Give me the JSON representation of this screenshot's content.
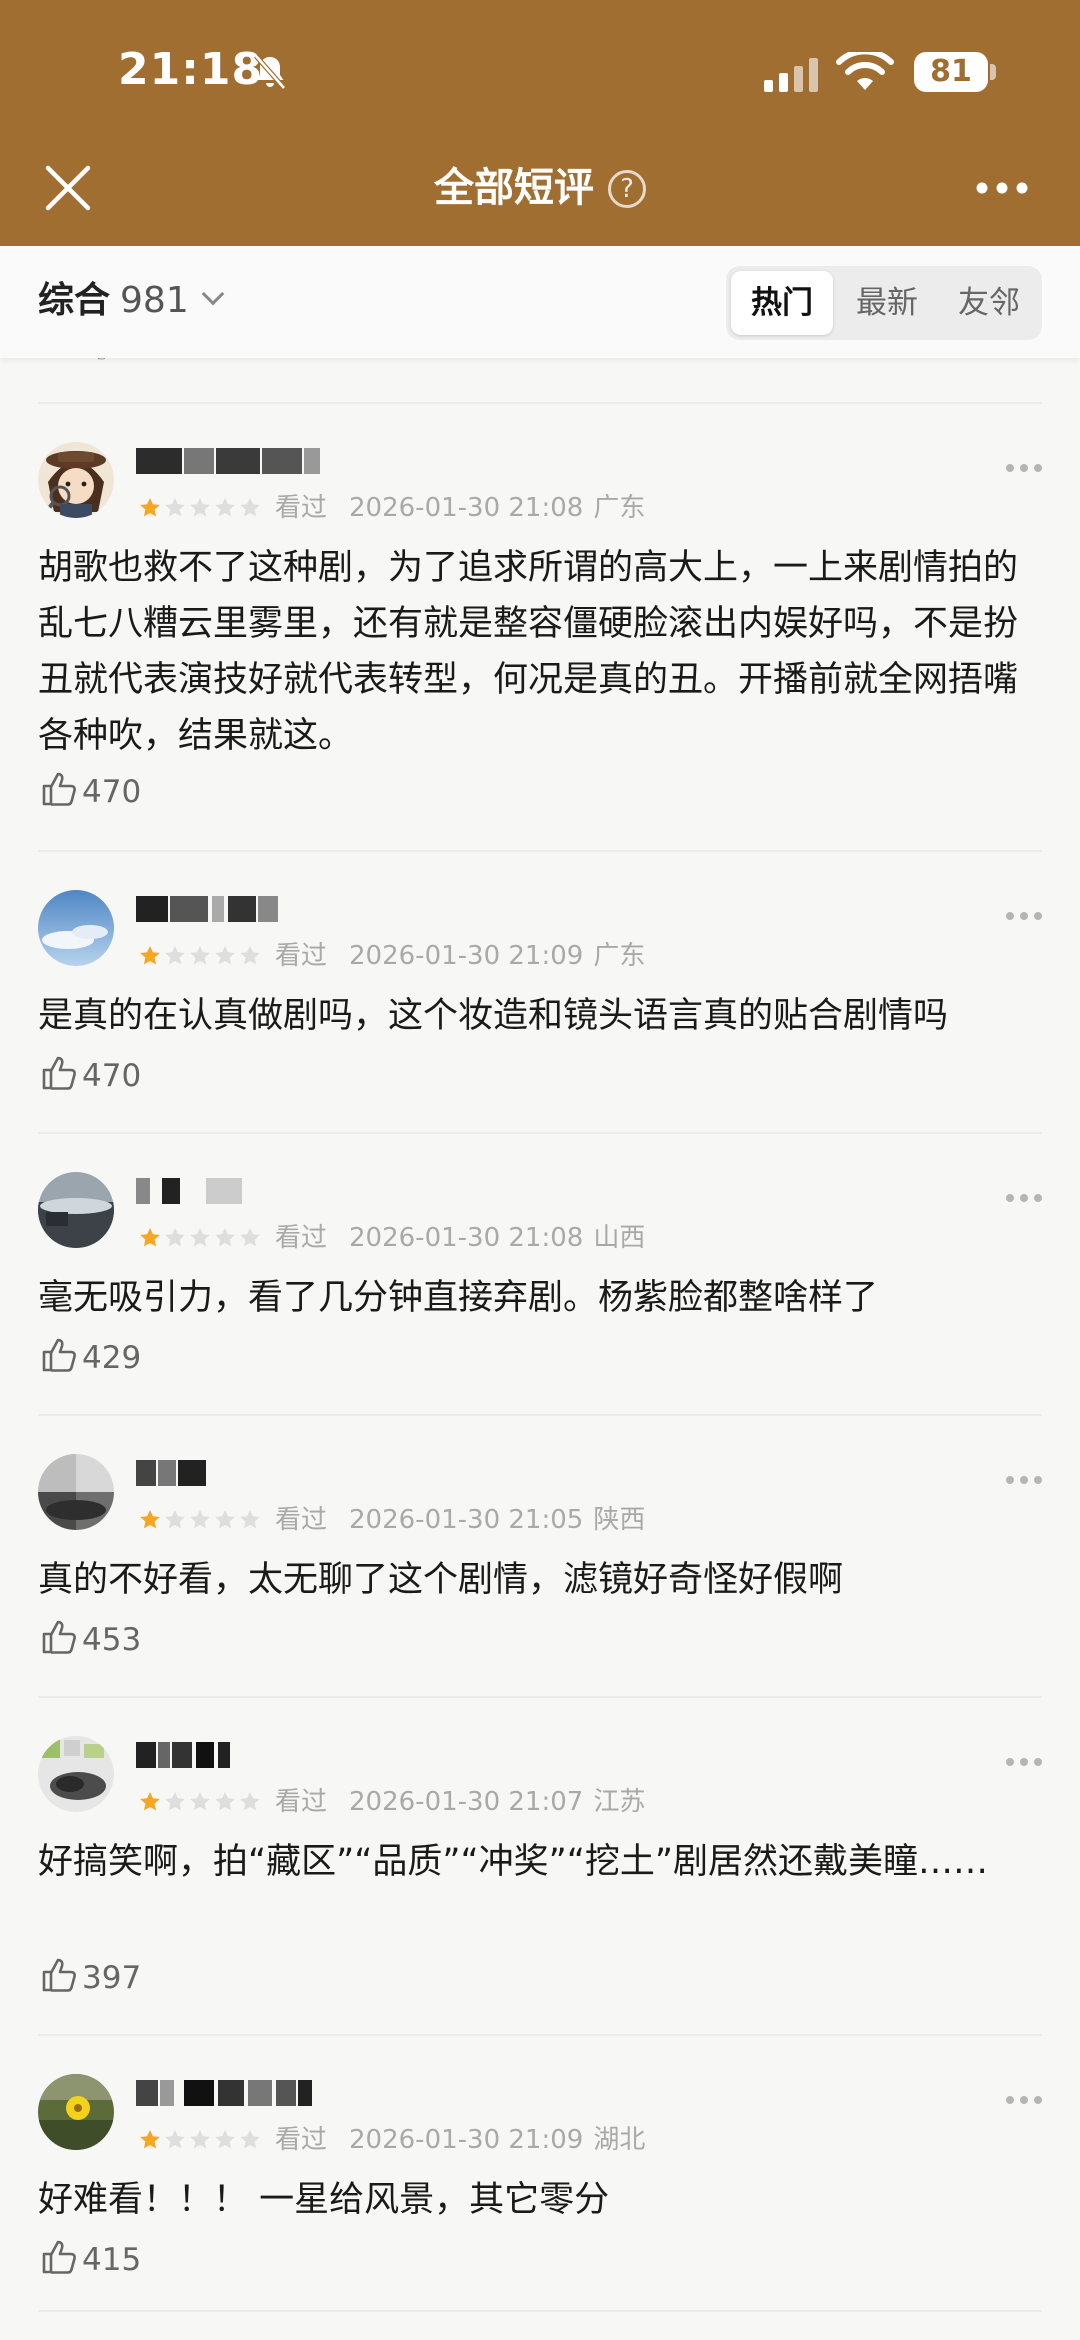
{
  "status_bar": {
    "time": "21:18",
    "battery": "81"
  },
  "nav": {
    "title": "全部短评",
    "help": "?"
  },
  "filter": {
    "sort_label": "综合",
    "count": "981",
    "tabs": [
      "热门",
      "最新",
      "友邻"
    ],
    "active_tab": "热门"
  },
  "comments": [
    {
      "status": "看过",
      "rating": 1,
      "rating_max": 5,
      "time": "2026-01-30 21:08",
      "location": "广东",
      "text": "胡歌也救不了这种剧，为了追求所谓的高大上，一上来剧情拍的乱七八糟云里雾里，还有就是整容僵硬脸滚出内娱好吗，不是扮丑就代表演技好就代表转型，何况是真的丑。开播前就全网捂嘴各种吹，结果就这。",
      "likes": "470"
    },
    {
      "status": "看过",
      "rating": 1,
      "rating_max": 5,
      "time": "2026-01-30 21:09",
      "location": "广东",
      "text": "是真的在认真做剧吗，这个妆造和镜头语言真的贴合剧情吗",
      "likes": "470"
    },
    {
      "status": "看过",
      "rating": 1,
      "rating_max": 5,
      "time": "2026-01-30 21:08",
      "location": "山西",
      "text": "毫无吸引力，看了几分钟直接弃剧。杨紫脸都整啥样了",
      "likes": "429"
    },
    {
      "status": "看过",
      "rating": 1,
      "rating_max": 5,
      "time": "2026-01-30 21:05",
      "location": "陕西",
      "text": "真的不好看，太无聊了这个剧情，滤镜好奇怪好假啊",
      "likes": "453"
    },
    {
      "status": "看过",
      "rating": 1,
      "rating_max": 5,
      "time": "2026-01-30 21:07",
      "location": "江苏",
      "text": "好搞笑啊，拍“藏区”“品质”“冲奖”“挖土”剧居然还戴美瞳……",
      "likes": "397"
    },
    {
      "status": "看过",
      "rating": 1,
      "rating_max": 5,
      "time": "2026-01-30 21:09",
      "location": "湖北",
      "text": "好难看！！！ 一星给风景，其它零分",
      "likes": "415"
    }
  ],
  "colors": {
    "header": "#a06e31",
    "star_on": "#f5a623",
    "star_off": "#dedede"
  }
}
